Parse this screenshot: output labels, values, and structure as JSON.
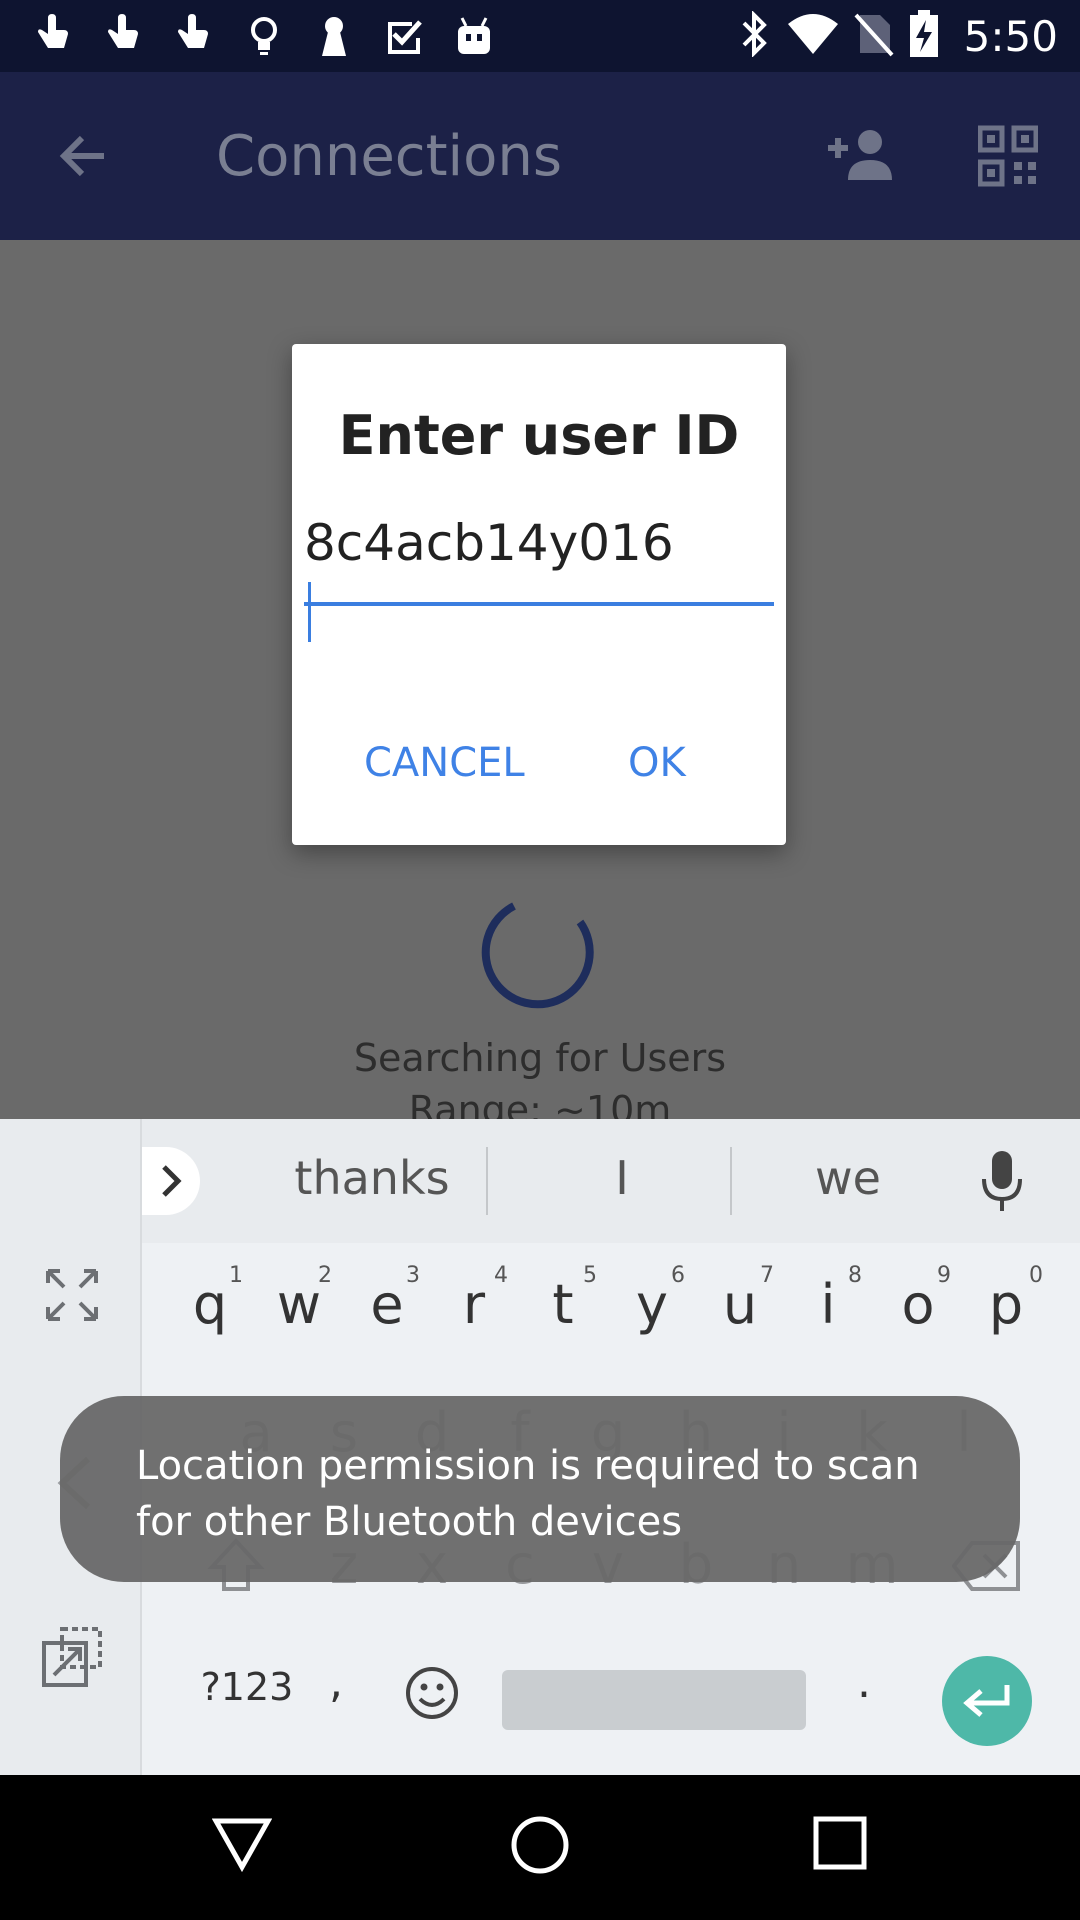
{
  "status_bar": {
    "time": "5:50",
    "left_icons": [
      "touch-icon",
      "touch-icon",
      "touch-icon",
      "lightbulb-icon",
      "keyhole-icon",
      "check-box-icon",
      "android-icon"
    ],
    "right_icons": [
      "bluetooth-icon",
      "wifi-icon",
      "no-sim-icon",
      "battery-charging-icon"
    ]
  },
  "app_bar": {
    "title": "Connections",
    "background": "#1c2147"
  },
  "content": {
    "status_line1": "Searching for Users",
    "status_line2": "Range: ~10m"
  },
  "dialog": {
    "title": "Enter user ID",
    "input_value": "8c4acb14y016",
    "cancel_label": "CANCEL",
    "ok_label": "OK",
    "accent": "#3f82e6"
  },
  "keyboard": {
    "suggestions": [
      "thanks",
      "I",
      "we"
    ],
    "row1": [
      "q",
      "w",
      "e",
      "r",
      "t",
      "y",
      "u",
      "i",
      "o",
      "p"
    ],
    "row1_hints": [
      "1",
      "2",
      "3",
      "4",
      "5",
      "6",
      "7",
      "8",
      "9",
      "0"
    ],
    "row2": [
      "a",
      "s",
      "d",
      "f",
      "g",
      "h",
      "j",
      "k",
      "l"
    ],
    "row3": [
      "z",
      "x",
      "c",
      "v",
      "b",
      "n",
      "m"
    ],
    "symbols_label": "?123",
    "comma_label": ",",
    "period_label": ".",
    "enter_color": "#4eb8a8"
  },
  "toast": {
    "message": "Location permission is required to scan for other Bluetooth devices"
  }
}
